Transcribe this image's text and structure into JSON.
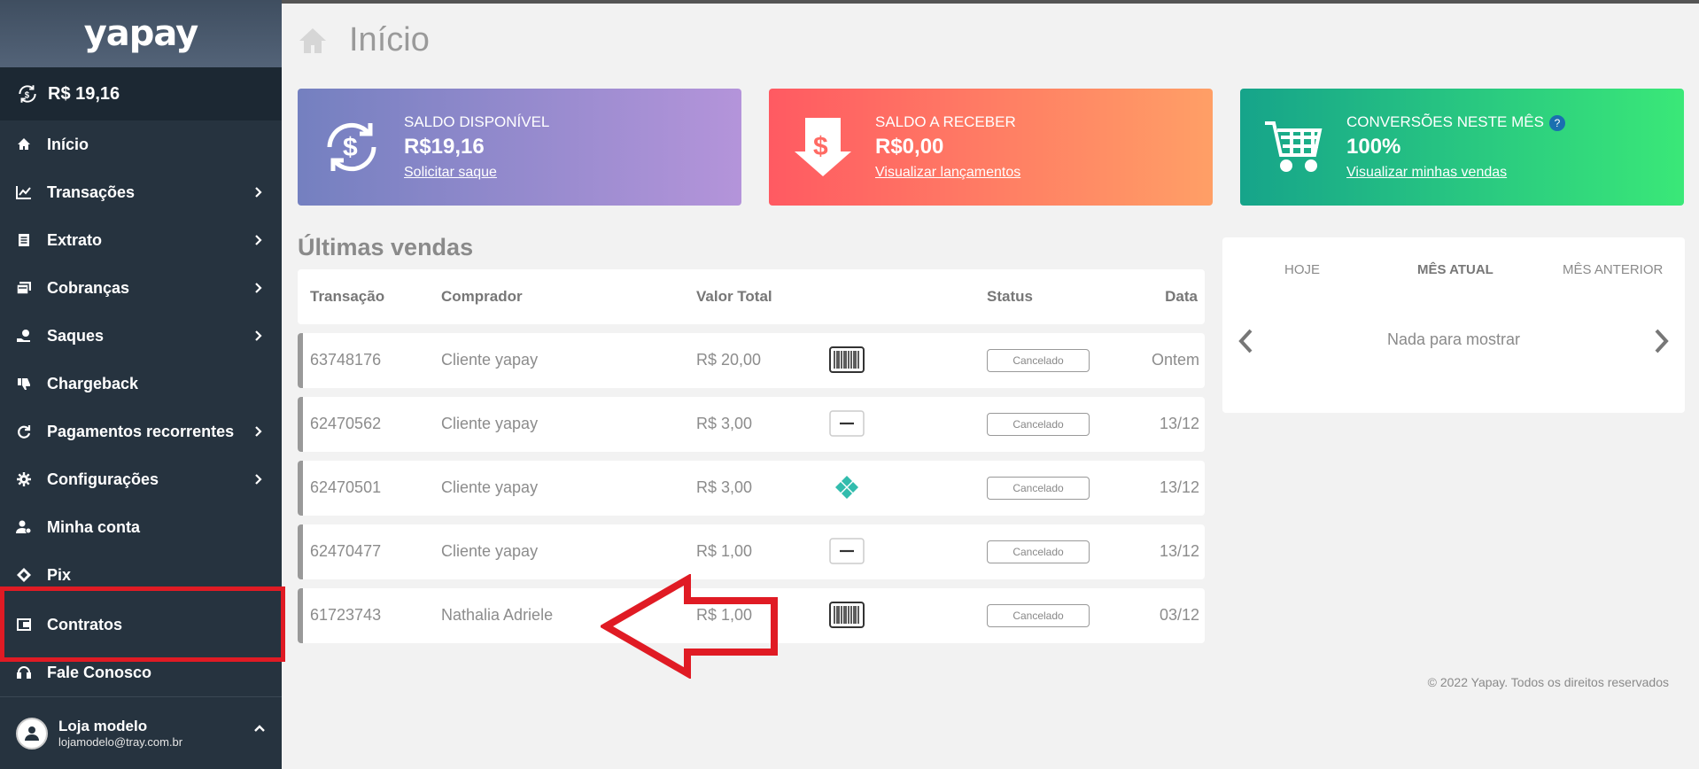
{
  "sidebar": {
    "logo": "yapay",
    "balance": "R$ 19,16",
    "items": [
      {
        "label": "Início"
      },
      {
        "label": "Transações"
      },
      {
        "label": "Extrato"
      },
      {
        "label": "Cobranças"
      },
      {
        "label": "Saques"
      },
      {
        "label": "Chargeback"
      },
      {
        "label": "Pagamentos recorrentes"
      },
      {
        "label": "Configurações"
      },
      {
        "label": "Minha conta"
      },
      {
        "label": "Pix"
      },
      {
        "label": "Contratos"
      },
      {
        "label": "Fale Conosco"
      }
    ],
    "user": {
      "name": "Loja modelo",
      "email": "lojamodelo@tray.com.br"
    }
  },
  "header": {
    "title": "Início"
  },
  "cards": [
    {
      "label": "SALDO DISPONÍVEL",
      "value": "R$19,16",
      "link": "Solicitar saque"
    },
    {
      "label": "SALDO A RECEBER",
      "value": "R$0,00",
      "link": "Visualizar lançamentos"
    },
    {
      "label": "CONVERSÕES NESTE MÊS",
      "value": "100%",
      "link": "Visualizar minhas vendas",
      "help": "?"
    }
  ],
  "sales": {
    "title": "Últimas vendas",
    "columns": {
      "transaction": "Transação",
      "buyer": "Comprador",
      "total": "Valor Total",
      "status": "Status",
      "date": "Data"
    },
    "rows": [
      {
        "id": "63748176",
        "buyer": "Cliente yapay",
        "total": "R$ 20,00",
        "payment": "boleto-icon",
        "status": "Cancelado",
        "date": "Ontem"
      },
      {
        "id": "62470562",
        "buyer": "Cliente yapay",
        "total": "R$ 3,00",
        "payment": "card-icon",
        "status": "Cancelado",
        "date": "13/12"
      },
      {
        "id": "62470501",
        "buyer": "Cliente yapay",
        "total": "R$ 3,00",
        "payment": "pix-icon",
        "status": "Cancelado",
        "date": "13/12"
      },
      {
        "id": "62470477",
        "buyer": "Cliente yapay",
        "total": "R$ 1,00",
        "payment": "card-icon",
        "status": "Cancelado",
        "date": "13/12"
      },
      {
        "id": "61723743",
        "buyer": "Nathalia Adriele",
        "total": "R$ 1,00",
        "payment": "boleto-icon",
        "status": "Cancelado",
        "date": "03/12"
      }
    ]
  },
  "panel": {
    "tabs": [
      "HOJE",
      "MÊS ATUAL",
      "MÊS ANTERIOR"
    ],
    "active_tab": "MÊS ATUAL",
    "empty": "Nada para mostrar"
  },
  "footer": "© 2022 Yapay. Todos os direitos reservados",
  "colors": {
    "sidebar": "#26333f",
    "highlight": "#e01b24",
    "pix": "#32bcad"
  }
}
